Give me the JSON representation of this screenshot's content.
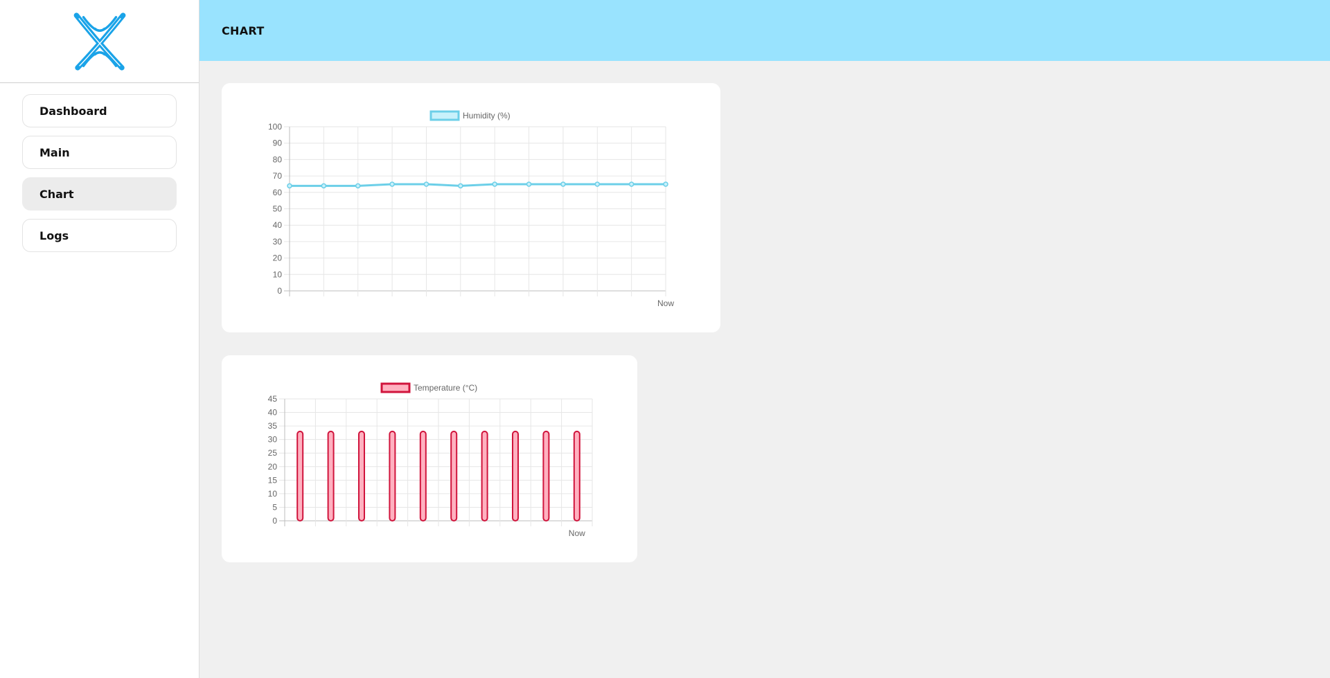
{
  "sidebar": {
    "logo": "x-logo-icon",
    "items": [
      {
        "label": "Dashboard",
        "active": false
      },
      {
        "label": "Main",
        "active": false
      },
      {
        "label": "Chart",
        "active": true
      },
      {
        "label": "Logs",
        "active": false
      }
    ]
  },
  "header": {
    "title": "CHART"
  },
  "colors": {
    "header_bg": "#99e3fe",
    "humidity_line": "#6ccfe8",
    "humidity_fill": "#c8f1fb",
    "temperature_border": "#d0143c",
    "temperature_fill": "#ffb1c0"
  },
  "chart_data": [
    {
      "type": "line",
      "series": [
        {
          "name": "Humidity (%)",
          "values": [
            64,
            64,
            64,
            65,
            65,
            64,
            65,
            65,
            65,
            65,
            65,
            65
          ]
        }
      ],
      "x_tick_labels": [
        "",
        "",
        "",
        "",
        "",
        "",
        "",
        "",
        "",
        "",
        "",
        "Now"
      ],
      "ylim": [
        0,
        100
      ],
      "y_ticks": [
        0,
        10,
        20,
        30,
        40,
        50,
        60,
        70,
        80,
        90,
        100
      ],
      "grid": true,
      "legend": "top"
    },
    {
      "type": "bar",
      "series": [
        {
          "name": "Temperature (°C)",
          "values": [
            33,
            33,
            33,
            33,
            33,
            33,
            33,
            33,
            33,
            33
          ]
        }
      ],
      "x_tick_labels": [
        "",
        "",
        "",
        "",
        "",
        "",
        "",
        "",
        "",
        "Now"
      ],
      "ylim": [
        0,
        45
      ],
      "y_ticks": [
        0,
        5,
        10,
        15,
        20,
        25,
        30,
        35,
        40,
        45
      ],
      "grid": true,
      "legend": "top"
    }
  ]
}
